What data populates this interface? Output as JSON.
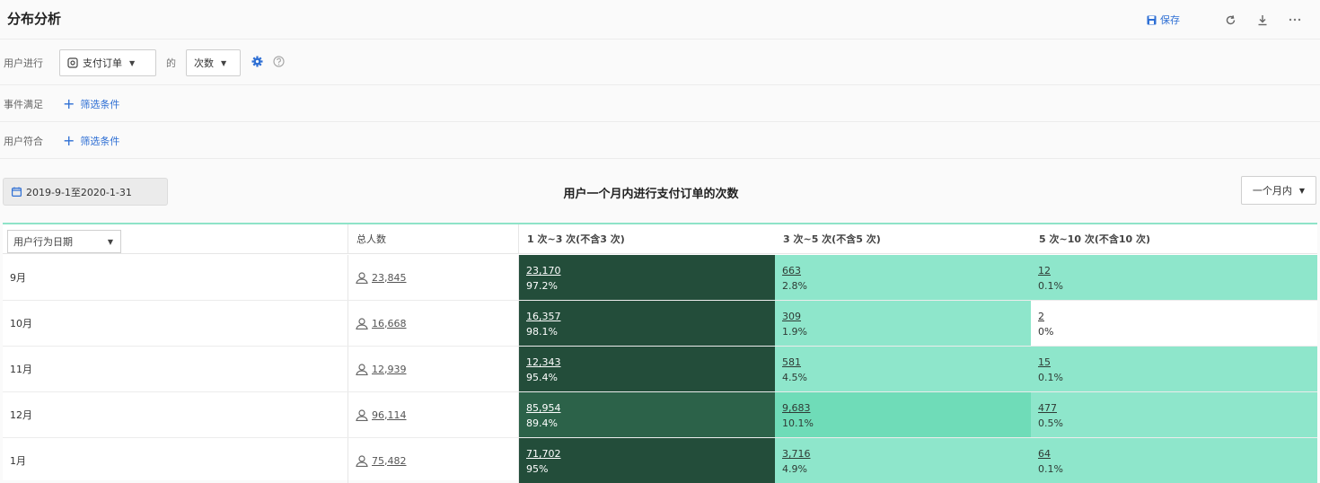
{
  "header": {
    "title": "分布分析",
    "save_label": "保存"
  },
  "filters": {
    "row1_label": "用户进行",
    "event_value": "支付订单",
    "de_label": "的",
    "count_value": "次数",
    "row2_label": "事件满足",
    "row3_label": "用户符合",
    "add_filter_label": "筛选条件"
  },
  "toolbar": {
    "date_range": "2019-9-1至2020-1-31",
    "chart_title": "用户一个月内进行支付订单的次数",
    "period_value": "一个月内"
  },
  "table": {
    "dimension_select": "用户行为日期",
    "headers": [
      "总人数",
      "1 次~3 次(不含3 次)",
      "3 次~5 次(不含5 次)",
      "5 次~10 次(不含10 次)"
    ],
    "rows": [
      {
        "label": "9月",
        "total": "23,845",
        "cells": [
          {
            "num": "23,170",
            "pct": "97.2%",
            "bg": "#234d3a",
            "fg": "#ffffff"
          },
          {
            "num": "663",
            "pct": "2.8%",
            "bg": "#8ee6cb",
            "fg": "#2f3b35"
          },
          {
            "num": "12",
            "pct": "0.1%",
            "bg": "#8ee6cb",
            "fg": "#2f3b35"
          }
        ]
      },
      {
        "label": "10月",
        "total": "16,668",
        "cells": [
          {
            "num": "16,357",
            "pct": "98.1%",
            "bg": "#234d3a",
            "fg": "#ffffff"
          },
          {
            "num": "309",
            "pct": "1.9%",
            "bg": "#8ee6cb",
            "fg": "#2f3b35"
          },
          {
            "num": "2",
            "pct": "0%",
            "bg": "#ffffff",
            "fg": "#333333"
          }
        ]
      },
      {
        "label": "11月",
        "total": "12,939",
        "cells": [
          {
            "num": "12,343",
            "pct": "95.4%",
            "bg": "#234d3a",
            "fg": "#ffffff"
          },
          {
            "num": "581",
            "pct": "4.5%",
            "bg": "#8ee6cb",
            "fg": "#2f3b35"
          },
          {
            "num": "15",
            "pct": "0.1%",
            "bg": "#8ee6cb",
            "fg": "#2f3b35"
          }
        ]
      },
      {
        "label": "12月",
        "total": "96,114",
        "cells": [
          {
            "num": "85,954",
            "pct": "89.4%",
            "bg": "#2c6249",
            "fg": "#ffffff"
          },
          {
            "num": "9,683",
            "pct": "10.1%",
            "bg": "#6fdcb8",
            "fg": "#2f3b35"
          },
          {
            "num": "477",
            "pct": "0.5%",
            "bg": "#8ee6cb",
            "fg": "#2f3b35"
          }
        ]
      },
      {
        "label": "1月",
        "total": "75,482",
        "cells": [
          {
            "num": "71,702",
            "pct": "95%",
            "bg": "#234d3a",
            "fg": "#ffffff"
          },
          {
            "num": "3,716",
            "pct": "4.9%",
            "bg": "#8ee6cb",
            "fg": "#2f3b35"
          },
          {
            "num": "64",
            "pct": "0.1%",
            "bg": "#8ee6cb",
            "fg": "#2f3b35"
          }
        ]
      }
    ]
  },
  "colors": {
    "accent": "#2e6fd4",
    "table_top_border": "#8ee3c8"
  },
  "icons": {
    "save": "floppy-icon",
    "refresh": "refresh-icon",
    "download": "download-icon",
    "more": "more-icon",
    "event": "event-icon",
    "settings": "gear-icon",
    "help": "help-icon",
    "calendar": "calendar-icon",
    "user": "user-icon"
  }
}
